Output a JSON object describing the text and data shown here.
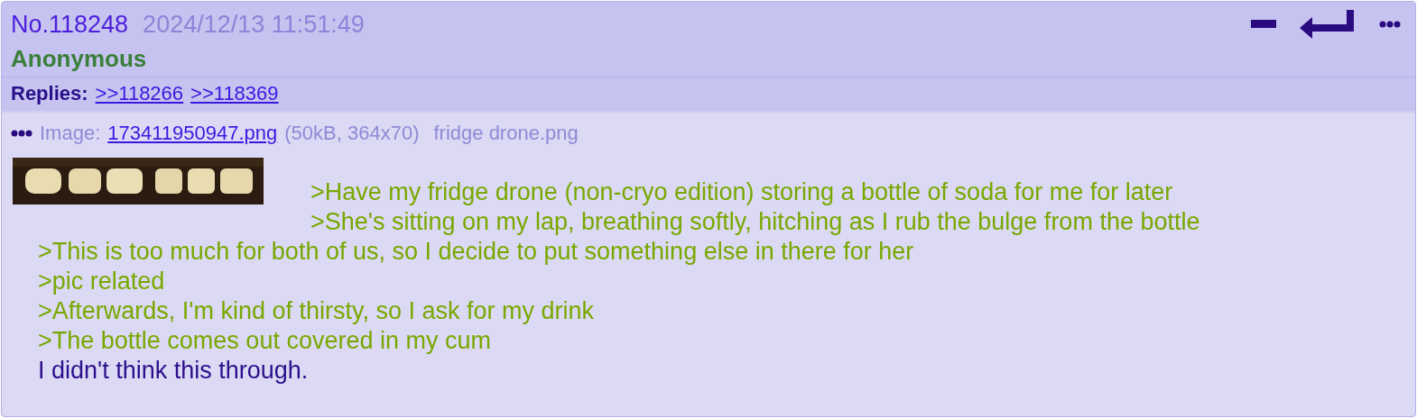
{
  "post": {
    "number": "No.118248",
    "date": "2024/12/13 11:51:49",
    "name": "Anonymous",
    "replies_label": "Replies:",
    "replies": [
      ">>118266",
      ">>118369"
    ],
    "file": {
      "label": "Image:",
      "link": "173411950947.png",
      "info": "(50kB, 364x70)",
      "original_name": "fridge drone.png"
    },
    "lines": [
      {
        "kind": "quote",
        "text": ">Have my fridge drone (non-cryo edition) storing a bottle of soda for me for later"
      },
      {
        "kind": "quote",
        "text": ">She's sitting on my lap, breathing softly, hitching as I rub the bulge from the bottle"
      },
      {
        "kind": "quote",
        "text": ">This is too much for both of us, so I decide to put something else in there for her"
      },
      {
        "kind": "quote",
        "text": ">pic related"
      },
      {
        "kind": "quote",
        "text": ">Afterwards, I'm kind of thirsty, so I ask for my drink"
      },
      {
        "kind": "quote",
        "text": ">The bottle comes out covered in my cum"
      },
      {
        "kind": "plain",
        "text": "I didn't think this through."
      }
    ]
  }
}
